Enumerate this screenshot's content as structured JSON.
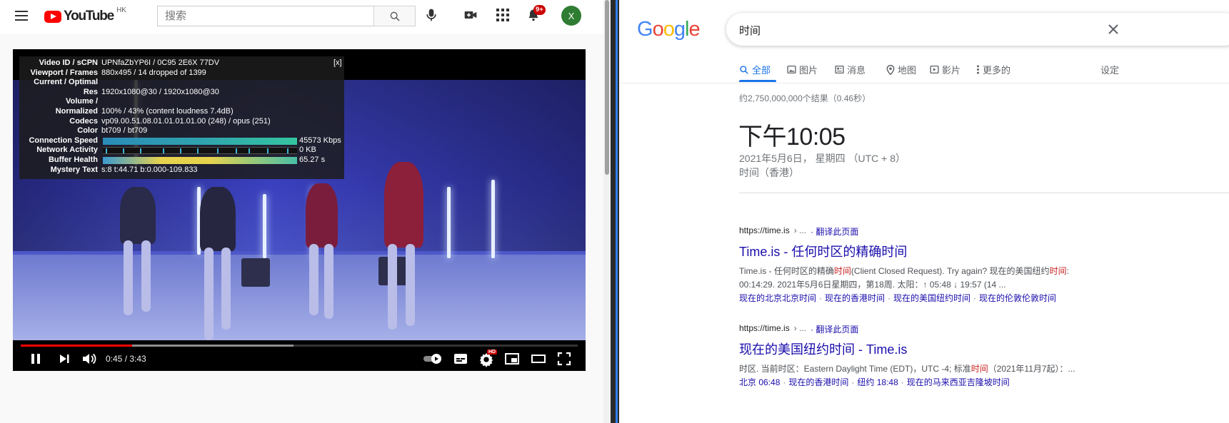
{
  "youtube": {
    "logo_text": "YouTube",
    "region": "HK",
    "search_placeholder": "搜索",
    "notification_count": "9+",
    "avatar_letter": "X",
    "stats": {
      "close": "[x]",
      "rows": [
        {
          "label": "Video ID / sCPN",
          "value": "UPNfaZbYP6I / 0C95 2E6X 77DV"
        },
        {
          "label": "Viewport / Frames",
          "value": "880x495 / 14 dropped of 1399"
        },
        {
          "label": "Current / Optimal",
          "value": ""
        },
        {
          "label": "Res",
          "value": "1920x1080@30 / 1920x1080@30"
        },
        {
          "label": "Volume /",
          "value": ""
        },
        {
          "label": "Normalized",
          "value": "100% / 43% (content loudness 7.4dB)"
        },
        {
          "label": "Codecs",
          "value": "vp09.00.51.08.01.01.01.01.00 (248) / opus (251)"
        },
        {
          "label": "Color",
          "value": "bt709 / bt709"
        }
      ],
      "connection_speed": {
        "label": "Connection Speed",
        "value": "45573 Kbps"
      },
      "network_activity": {
        "label": "Network Activity",
        "value": "0 KB"
      },
      "buffer_health": {
        "label": "Buffer Health",
        "value": "65.27 s"
      },
      "mystery_text": {
        "label": "Mystery Text",
        "value": "s:8 t:44.71 b:0.000-109.833"
      }
    },
    "player": {
      "time_display": "0:45 / 3:43",
      "played_fraction": 0.2,
      "buffered_fraction": 0.49,
      "hd_badge": "HD"
    }
  },
  "google": {
    "logo_letters": [
      {
        "ch": "G",
        "color": "#4285F4"
      },
      {
        "ch": "o",
        "color": "#EA4335"
      },
      {
        "ch": "o",
        "color": "#FBBC05"
      },
      {
        "ch": "g",
        "color": "#4285F4"
      },
      {
        "ch": "l",
        "color": "#34A853"
      },
      {
        "ch": "e",
        "color": "#EA4335"
      }
    ],
    "query": "时间",
    "tabs": {
      "all": "全部",
      "images": "图片",
      "news": "消息",
      "maps": "地图",
      "videos": "影片",
      "more": "更多的"
    },
    "settings": "设定",
    "result_stats": "约2,750,000,000个结果（0.46秒）",
    "time_card": {
      "time": "下午10:05",
      "date": "2021年5月6日， 星期四 （UTC + 8）",
      "zone": "时间（香港）"
    },
    "results": [
      {
        "cite": "https://time.is",
        "cite_tail": "› ...",
        "translate": "· 翻译此页面",
        "title": "Time.is - 任何时区的精确时间",
        "snippet_1a": "Time.is - 任何时区的精确",
        "snippet_1b": "时间",
        "snippet_1c": "(Client Closed Request). Try again? 现在的美国纽约",
        "snippet_1d": "时间",
        "snippet_1e": ":",
        "snippet_2": "00:14:29. 2021年5月6日星期四，第18周. 太阳：↑ 05:48 ↓ 19:57 (14 ...",
        "links": [
          "现在的北京北京时间",
          "现在的香港时间",
          "现在的美国纽约时间",
          "现在的伦敦伦敦时间"
        ]
      },
      {
        "cite": "https://time.is",
        "cite_tail": "› ...",
        "translate": "· 翻译此页面",
        "title": "现在的美国纽约时间 - Time.is",
        "snippet_1a": "时区. 当前时区：Eastern Daylight Time (EDT)，UTC -4; 标准",
        "snippet_1b": "时间",
        "snippet_1c": "（2021年11月7起）：...",
        "links": [
          "北京 06:48",
          "现在的香港时间",
          "纽约 18:48",
          "现在的马来西亚吉隆坡时间"
        ]
      }
    ]
  }
}
